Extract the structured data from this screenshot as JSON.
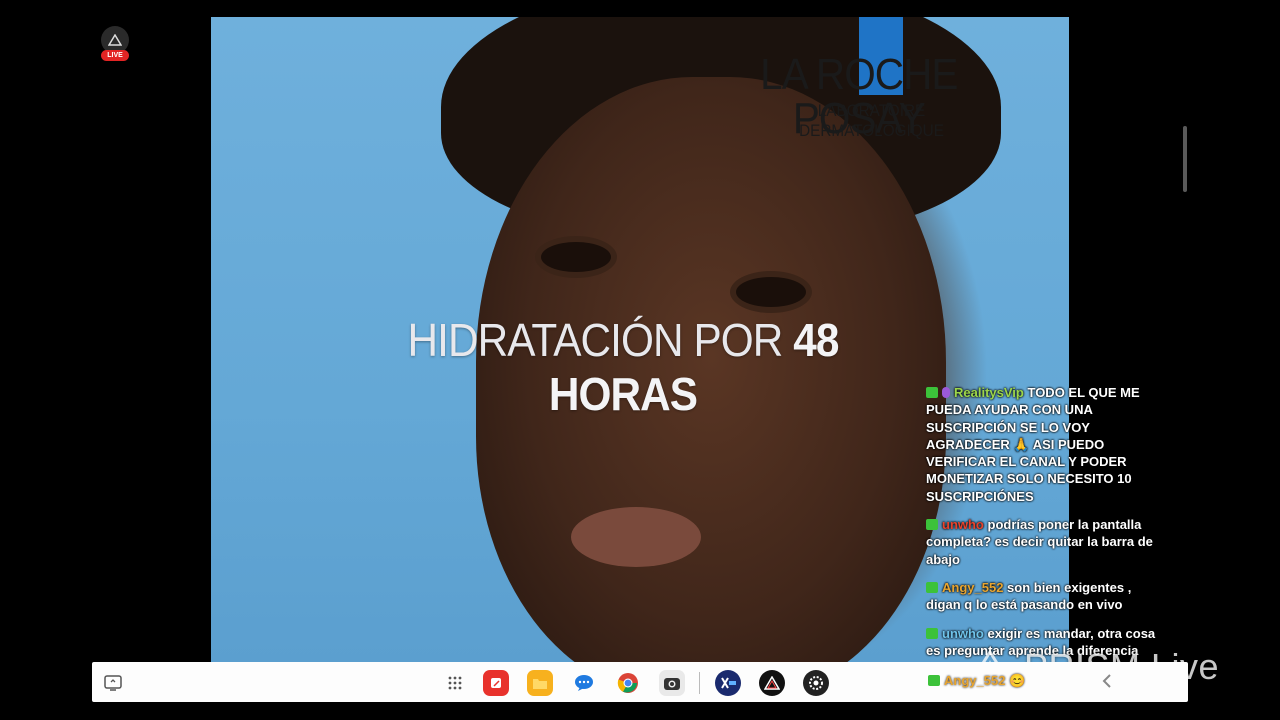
{
  "live_badge": {
    "label": "LIVE"
  },
  "video": {
    "brand_name": "LA ROCHE POSAY",
    "brand_subtitle": "LABORATOIRE DERMATOLOGIQUE",
    "headline_light": "HIDRATACIÓN POR",
    "headline_bold": "48 HORAS"
  },
  "chat": {
    "messages": [
      {
        "user": "RealitysVip",
        "text": "TODO EL QUE ME PUEDA AYUDAR CON UNA SUSCRIPCIÓN SE LO VOY AGRADECER 🙏 ASI PUEDO VERIFICAR EL CANAL Y PODER MONETIZAR SOLO NECESITO 10 SUSCRIPCIÓNES"
      },
      {
        "user": "unwho",
        "text": "podrías poner la pantalla completa? es decir quitar la barra de abajo"
      },
      {
        "user": "Angy_552",
        "text": "son bien exigentes , digan q lo está pasando en vivo"
      },
      {
        "user": "unwho",
        "text": "exigir es mandar, otra cosa es preguntar aprende la diferencia"
      },
      {
        "user": "Angy_552",
        "text": "😊"
      }
    ]
  },
  "watermark": {
    "text": "PRISM Live"
  },
  "taskbar": {
    "icons": [
      "recent-apps-icon",
      "app-drawer-icon",
      "notes-app-icon",
      "files-app-icon",
      "messages-app-icon",
      "chrome-app-icon",
      "camera-app-icon",
      "xvideo-app-icon",
      "prism-app-icon",
      "settings-app-icon",
      "back-icon"
    ]
  },
  "colors": {
    "background": "#000000",
    "sky_blue": "#64a8d6",
    "chat_username_green": "#9cd64a",
    "chat_username_red": "#e8432c",
    "chat_username_orange": "#e8a530",
    "chat_username_blue": "#6fc3ea",
    "live_red": "#e32424",
    "brand_blue": "#1f74c6"
  }
}
